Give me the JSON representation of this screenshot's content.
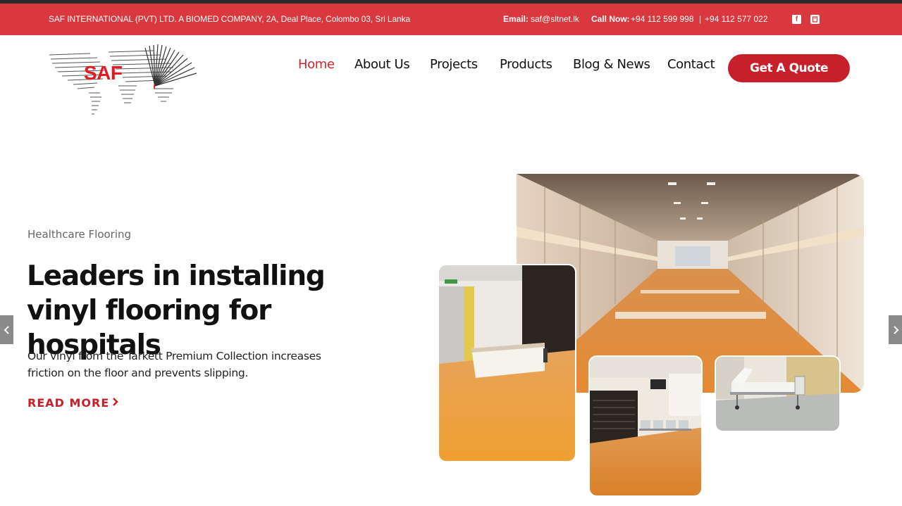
{
  "topbar": {
    "address": "SAF INTERNATIONAL (PVT) LTD. A  BIOMED COMPANY, 2A, Deal Place, Colombo 03, Sri Lanka",
    "email_label": "Email:",
    "email_value": "saf@sltnet.lk",
    "call_label": "Call Now:",
    "phone1": "+94 112 599 998",
    "separator": "|",
    "phone2": "+94 112 577 022",
    "social_icons": [
      "facebook-icon",
      "book-icon"
    ]
  },
  "logo": {
    "text": "SAF",
    "brand_color": "#e21b23"
  },
  "nav": {
    "items": [
      {
        "label": "Home",
        "active": true
      },
      {
        "label": "About Us",
        "active": false
      },
      {
        "label": "Projects",
        "active": false
      },
      {
        "label": "Products",
        "active": false
      },
      {
        "label": "Blog & News",
        "active": false
      },
      {
        "label": "Contact",
        "active": false
      }
    ],
    "cta_label": "Get A Quote"
  },
  "hero": {
    "eyebrow": "Healthcare Flooring",
    "headline": "Leaders in installing vinyl flooring for hospitals",
    "description": "Our vinyl from the Tarkett Premium Collection increases friction on the floor and prevents slipping.",
    "read_more": "READ MORE",
    "read_more_icon": "chevron-right-icon"
  },
  "slider": {
    "prev_icon": "chevron-left-icon",
    "next_icon": "chevron-right-icon"
  },
  "colors": {
    "accent": "#c8202a",
    "topbar_bg": "#d9383e",
    "floor_orange": "#e88a3a"
  }
}
